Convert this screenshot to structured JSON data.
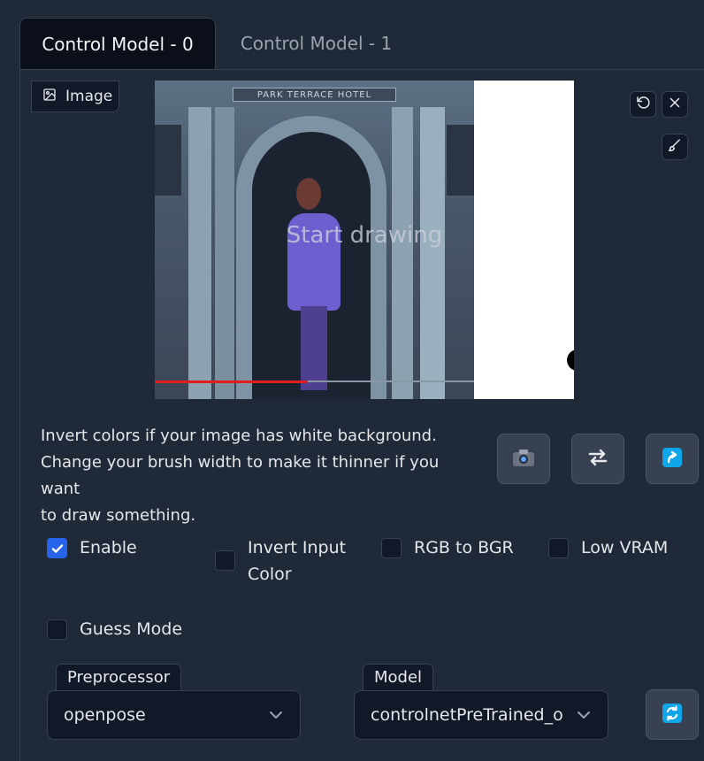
{
  "tabs": [
    {
      "label": "Control Model - 0",
      "active": true
    },
    {
      "label": "Control Model - 1",
      "active": false
    }
  ],
  "image_panel": {
    "label": "Image",
    "canvas_hint": "Start drawing",
    "photo_sign_text": "PARK TERRACE HOTEL",
    "video_progress": 0.48
  },
  "instructions": {
    "line1": "Invert colors if your image has white background.",
    "line2": "Change your brush width to make it thinner if you want",
    "line3": "to draw something."
  },
  "action_icons": [
    "undo-icon",
    "close-icon",
    "brush-icon",
    "camera-icon",
    "swap-icon",
    "send-icon",
    "refresh-icon"
  ],
  "checkboxes": {
    "enable": {
      "label": "Enable",
      "checked": true
    },
    "invert_input_color": {
      "label": "Invert Input Color",
      "checked": false
    },
    "rgb_to_bgr": {
      "label": "RGB to BGR",
      "checked": false
    },
    "low_vram": {
      "label": "Low VRAM",
      "checked": false
    },
    "guess_mode": {
      "label": "Guess Mode",
      "checked": false
    }
  },
  "preprocessor": {
    "label": "Preprocessor",
    "value": "openpose"
  },
  "model": {
    "label": "Model",
    "value": "controlnetPreTrained_o"
  },
  "colors": {
    "background": "#1f2937",
    "accent": "#2563eb",
    "send_icon": "#0ea5e9"
  }
}
